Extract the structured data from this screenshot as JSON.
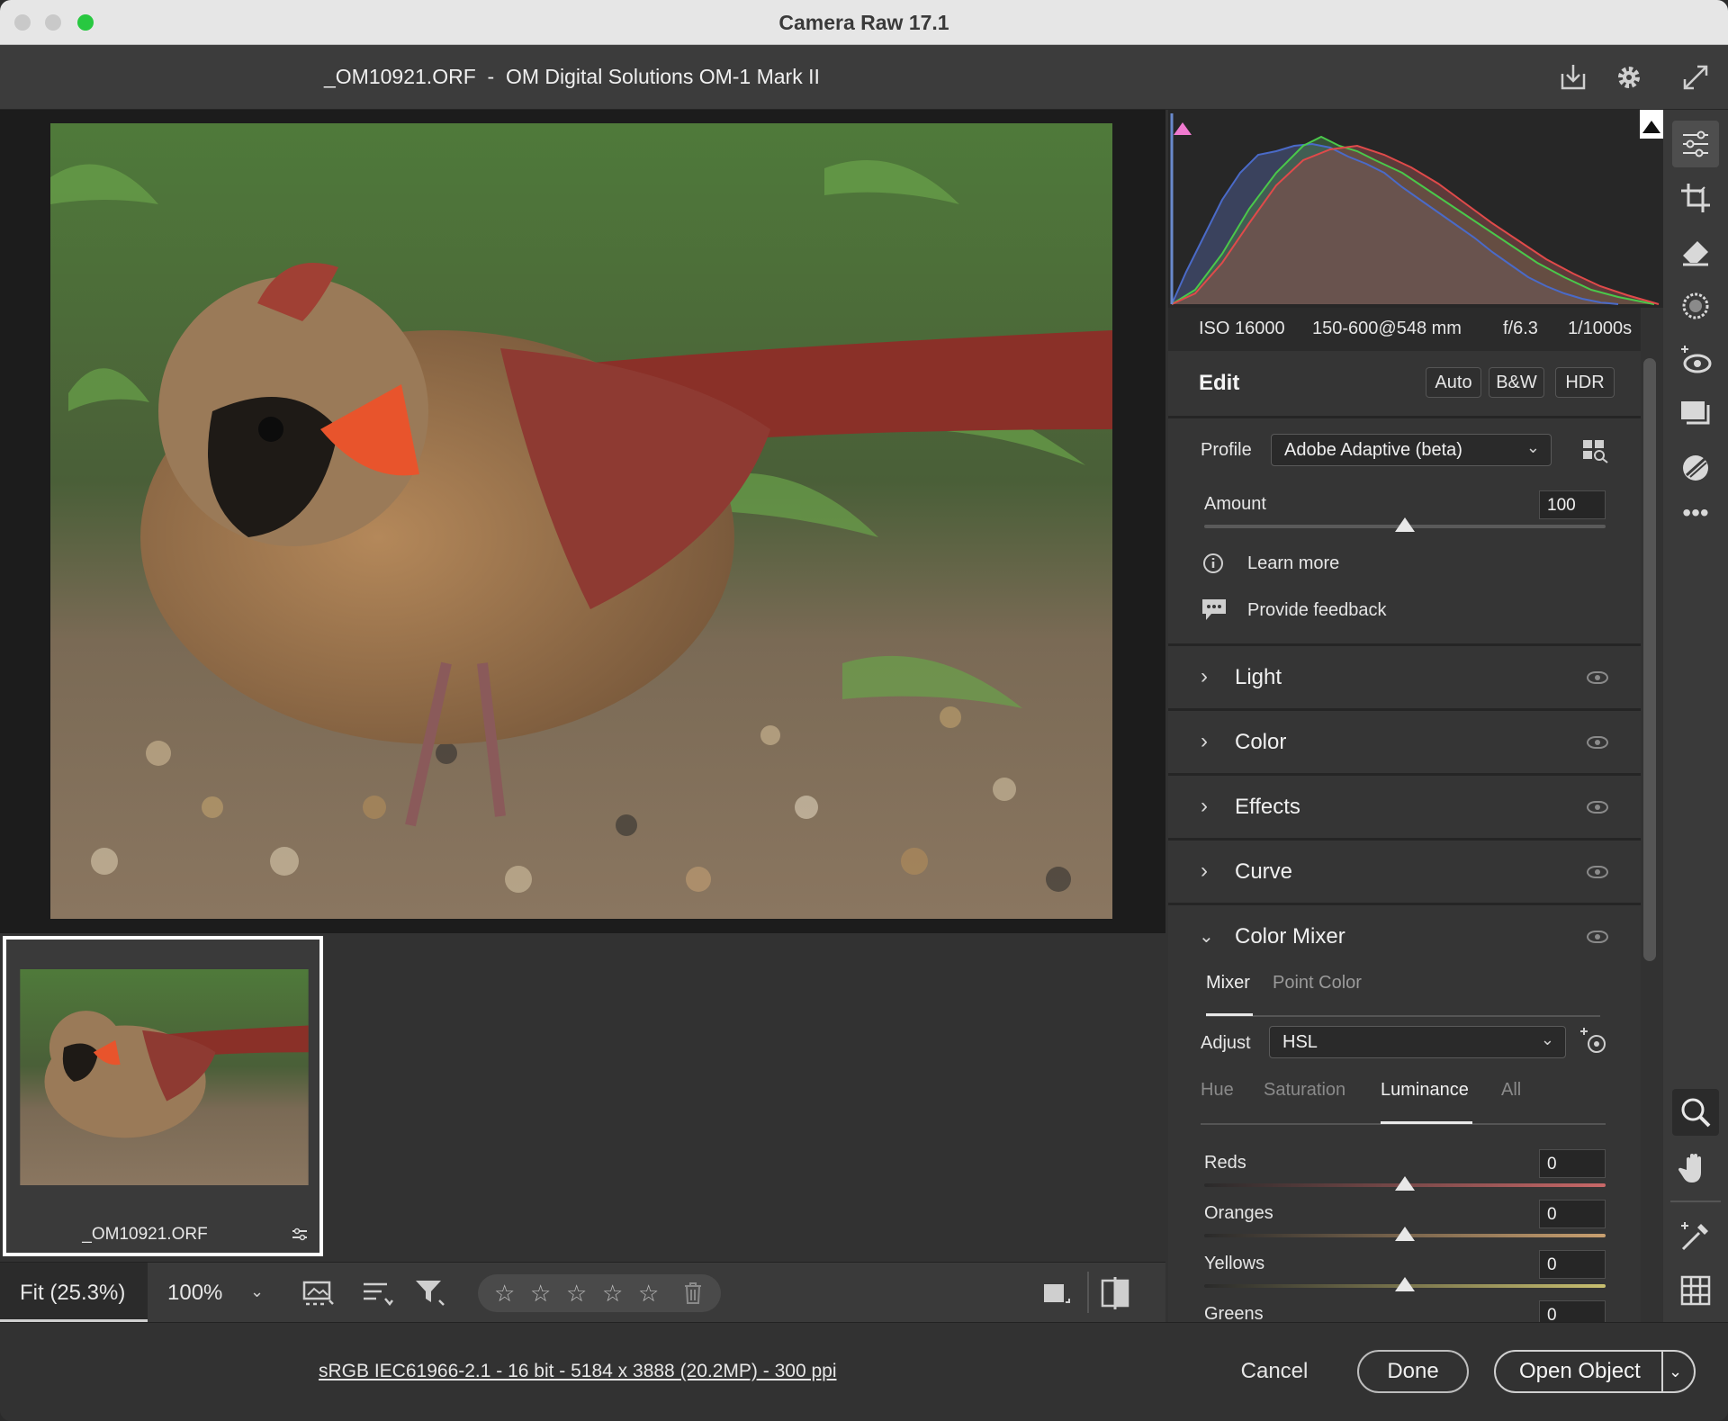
{
  "window": {
    "title": "Camera Raw 17.1"
  },
  "header": {
    "file_info": "_OM10921.ORF  -  OM Digital Solutions OM-1 Mark II"
  },
  "header_icons": [
    "save-icon",
    "gear-icon",
    "fullscreen-icon"
  ],
  "metadata": {
    "iso": "ISO 16000",
    "lens": "150-600@548 mm",
    "aperture": "f/6.3",
    "shutter": "1/1000s"
  },
  "edit": {
    "title": "Edit",
    "auto_label": "Auto",
    "bw_label": "B&W",
    "hdr_label": "HDR",
    "profile_label": "Profile",
    "profile_value": "Adobe Adaptive (beta)",
    "amount_label": "Amount",
    "amount_value": "100",
    "amount_fraction": 0.5,
    "learn_more": "Learn more",
    "provide_feedback": "Provide feedback"
  },
  "sections": [
    {
      "label": "Light",
      "expanded": false
    },
    {
      "label": "Color",
      "expanded": false
    },
    {
      "label": "Effects",
      "expanded": false
    },
    {
      "label": "Curve",
      "expanded": false
    },
    {
      "label": "Color Mixer",
      "expanded": true
    }
  ],
  "color_mixer": {
    "tabs": [
      "Mixer",
      "Point Color"
    ],
    "active_tab": "Mixer",
    "adjust_label": "Adjust",
    "adjust_value": "HSL",
    "subtabs": [
      "Hue",
      "Saturation",
      "Luminance",
      "All"
    ],
    "active_subtab": "Luminance",
    "sliders": [
      {
        "label": "Reds",
        "value": "0",
        "color": "#c96868"
      },
      {
        "label": "Oranges",
        "value": "0",
        "color": "#c9a070"
      },
      {
        "label": "Yellows",
        "value": "0",
        "color": "#c9c070"
      },
      {
        "label": "Greens",
        "value": "0",
        "color": "#70b070"
      }
    ]
  },
  "filmstrip": {
    "filename": "_OM10921.ORF"
  },
  "bottombar": {
    "zoom_fit": "Fit (25.3%)",
    "zoom_100": "100%"
  },
  "rating": {
    "stars": 0,
    "max": 5
  },
  "footer": {
    "workflow_link": "sRGB IEC61966-2.1 - 16 bit - 5184 x 3888 (20.2MP) - 300 ppi",
    "cancel": "Cancel",
    "done": "Done",
    "open_object": "Open Object"
  },
  "tool_icons": [
    "edit-sliders-icon",
    "crop-icon",
    "eraser-icon",
    "masking-icon",
    "red-eye-icon",
    "snapshots-icon",
    "presets-icon",
    "more-icon",
    "zoom-icon",
    "hand-icon",
    "color-sampler-icon",
    "grid-icon"
  ],
  "colors": {
    "accent": "#ffffff",
    "panel": "#353535",
    "background": "#2b2b2b"
  }
}
